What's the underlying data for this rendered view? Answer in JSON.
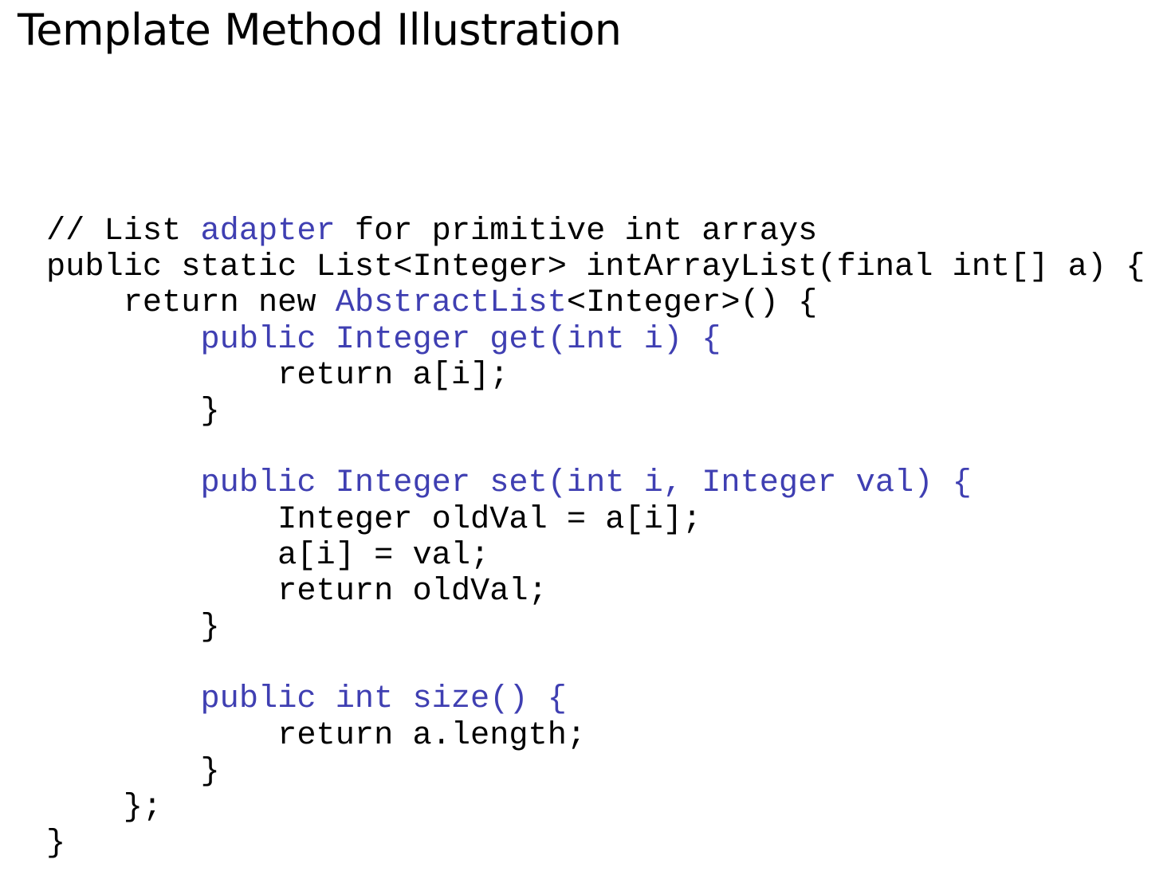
{
  "slide": {
    "title": "Template Method Illustration"
  },
  "colors": {
    "text": "#000000",
    "highlight": "#3f3fb2"
  },
  "code": {
    "lines": [
      {
        "segments": [
          {
            "text": "// List ",
            "hl": false
          },
          {
            "text": "adapter",
            "hl": true
          },
          {
            "text": " for primitive int arrays",
            "hl": false
          }
        ]
      },
      {
        "segments": [
          {
            "text": "public static List<Integer> intArrayList(final int[] a) {",
            "hl": false
          }
        ]
      },
      {
        "segments": [
          {
            "text": "    return new ",
            "hl": false
          },
          {
            "text": "AbstractList",
            "hl": true
          },
          {
            "text": "<Integer>() {",
            "hl": false
          }
        ]
      },
      {
        "segments": [
          {
            "text": "        ",
            "hl": false
          },
          {
            "text": "public Integer get(int i) {",
            "hl": true
          }
        ]
      },
      {
        "segments": [
          {
            "text": "            return a[i];",
            "hl": false
          }
        ]
      },
      {
        "segments": [
          {
            "text": "        }",
            "hl": false
          }
        ]
      },
      {
        "segments": [
          {
            "text": "",
            "hl": false
          }
        ]
      },
      {
        "segments": [
          {
            "text": "        ",
            "hl": false
          },
          {
            "text": "public Integer set(int i, Integer val) {",
            "hl": true
          }
        ]
      },
      {
        "segments": [
          {
            "text": "            Integer oldVal = a[i];",
            "hl": false
          }
        ]
      },
      {
        "segments": [
          {
            "text": "            a[i] = val;",
            "hl": false
          }
        ]
      },
      {
        "segments": [
          {
            "text": "            return oldVal;",
            "hl": false
          }
        ]
      },
      {
        "segments": [
          {
            "text": "        }",
            "hl": false
          }
        ]
      },
      {
        "segments": [
          {
            "text": "",
            "hl": false
          }
        ]
      },
      {
        "segments": [
          {
            "text": "        ",
            "hl": false
          },
          {
            "text": "public int size() {",
            "hl": true
          }
        ]
      },
      {
        "segments": [
          {
            "text": "            return a.length;",
            "hl": false
          }
        ]
      },
      {
        "segments": [
          {
            "text": "        }",
            "hl": false
          }
        ]
      },
      {
        "segments": [
          {
            "text": "    };",
            "hl": false
          }
        ]
      },
      {
        "segments": [
          {
            "text": "}",
            "hl": false
          }
        ]
      }
    ]
  }
}
